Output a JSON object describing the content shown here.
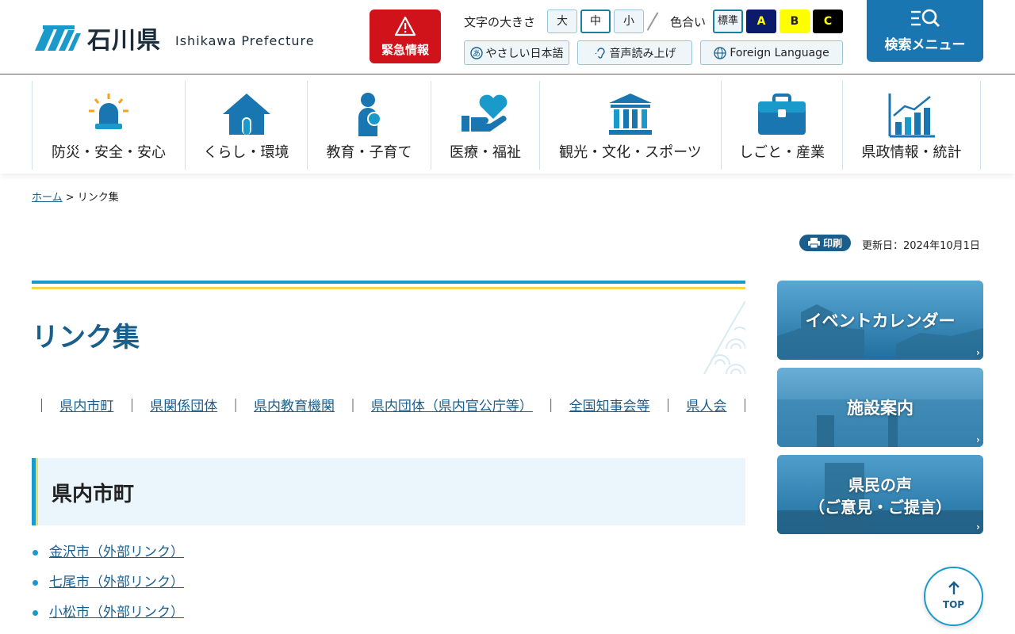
{
  "header": {
    "logo_ja": "石川県",
    "logo_en": "Ishikawa Prefecture",
    "emergency_label": "緊急情報",
    "font_size_label": "文字の大きさ",
    "font_sizes": [
      "大",
      "中",
      "小"
    ],
    "color_label": "色合い",
    "color_options": [
      "標準",
      "A",
      "B",
      "C"
    ],
    "easy_japanese": "やさしい日本語",
    "read_aloud": "音声読み上げ",
    "foreign_language": "Foreign Language",
    "search_menu": "検索メニュー"
  },
  "nav": {
    "items": [
      {
        "label": "防災・安全・安心",
        "icon": "siren-icon"
      },
      {
        "label": "くらし・環境",
        "icon": "house-icon"
      },
      {
        "label": "教育・子育て",
        "icon": "parent-child-icon"
      },
      {
        "label": "医療・福祉",
        "icon": "heart-hand-icon"
      },
      {
        "label": "観光・文化・スポーツ",
        "icon": "museum-icon"
      },
      {
        "label": "しごと・産業",
        "icon": "briefcase-icon"
      },
      {
        "label": "県政情報・統計",
        "icon": "bar-chart-icon"
      }
    ]
  },
  "breadcrumb": {
    "home": "ホーム",
    "separator": " > ",
    "current": "リンク集"
  },
  "meta": {
    "print_label": "印刷",
    "updated": "更新日：2024年10月1日"
  },
  "main": {
    "title": "リンク集",
    "anchors": [
      "県内市町",
      "県関係団体",
      "県内教育機関",
      "県内団体（県内官公庁等）",
      "全国知事会等",
      "県人会"
    ],
    "anchor_sep": "｜",
    "section_title": "県内市町",
    "links": [
      "金沢市（外部リンク）",
      "七尾市（外部リンク）",
      "小松市（外部リンク）"
    ]
  },
  "side": {
    "banners": [
      {
        "label": "イベントカレンダー"
      },
      {
        "label": "施設案内"
      },
      {
        "label_line1": "県民の声",
        "label_line2": "（ご意見・ご提言）"
      }
    ]
  },
  "top_button": "TOP",
  "colors": {
    "brand_blue": "#1a76b0",
    "accent_cyan": "#1a9acb",
    "accent_yellow": "#f6d84a",
    "emergency_red": "#d0121b",
    "link": "#1a5f8c"
  }
}
